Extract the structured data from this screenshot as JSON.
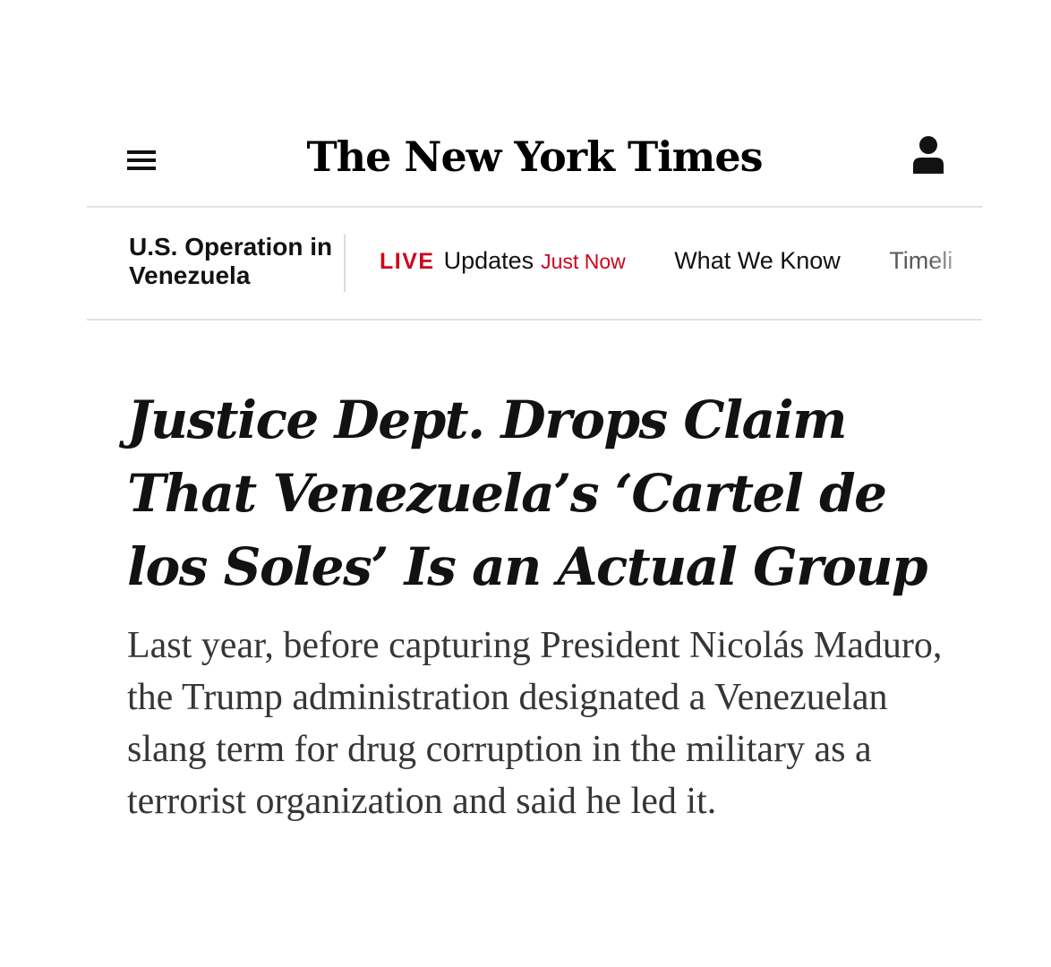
{
  "masthead": {
    "logo_text": "The New York Times",
    "menu_icon": "hamburger-menu-icon",
    "account_icon": "user-account-icon"
  },
  "subnav": {
    "section_name": "U.S. Operation in Venezuela",
    "live_label": "LIVE",
    "updates_label": "Updates",
    "updated_time": "Just Now",
    "links": [
      "What We Know",
      "Timeli"
    ]
  },
  "article": {
    "headline": "Justice Dept. Drops Claim That Venezuela’s ‘Cartel de los Soles’ Is an Actual Group",
    "summary": "Last year, before capturing President Nicolás Maduro, the Trump administration designated a Venezuelan slang term for drug corruption in the military as a terrorist organization and said he led it."
  },
  "colors": {
    "live_red": "#d0021b",
    "text": "#121212",
    "summary_text": "#363636",
    "rule": "#e2e2e2"
  }
}
